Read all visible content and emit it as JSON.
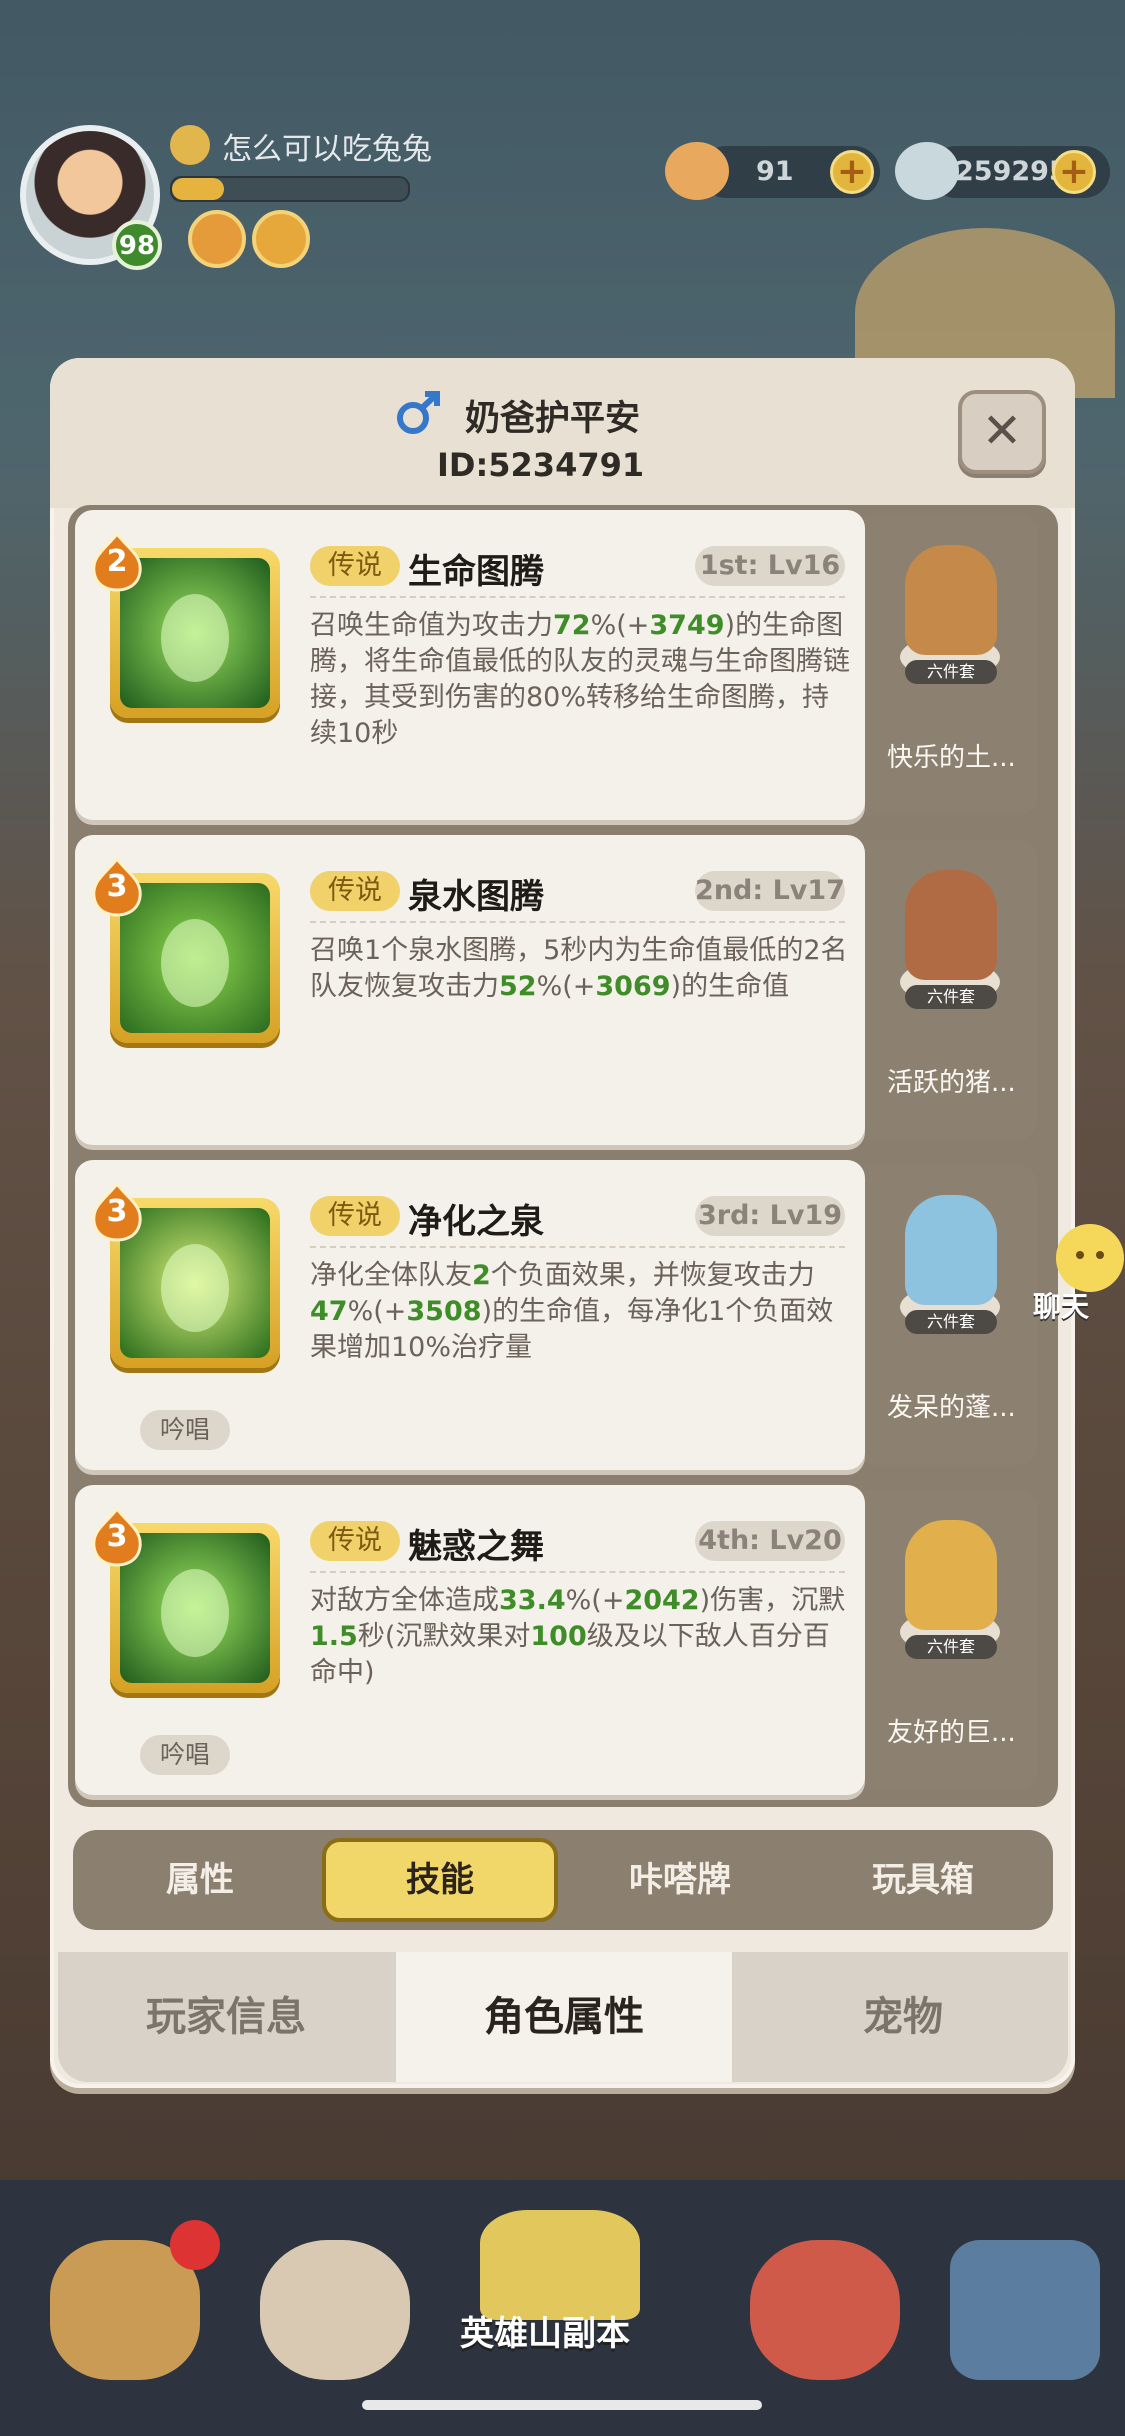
{
  "hud": {
    "player_name": "怎么可以吃兔兔",
    "level": "98",
    "xp_fraction": 0.22,
    "currency": [
      {
        "icon": "shell-currency-icon",
        "value": "91"
      },
      {
        "icon": "pearl-currency-icon",
        "value": "259295"
      }
    ],
    "plus_symbol": "+"
  },
  "dialog": {
    "gender_icon": "male-symbol-icon",
    "owner_name": "奶爸护平安",
    "owner_id": "ID:5234791",
    "close_symbol": "✕"
  },
  "skills": [
    {
      "stars": "2",
      "tag": "传说",
      "name": "生命图腾",
      "rank": "1st: Lv16",
      "desc_parts": [
        "召唤生命值为攻击力",
        "72",
        "%(+",
        "3749",
        ")的生命图腾，将生命值最低的队友的灵魂与生命图腾链接，其受到伤害的80%转移给生命图腾，持续10秒"
      ],
      "chant": "",
      "icon": "life-totem-icon",
      "figure_name": "快乐的土...",
      "figure_icon": "happy-earth-figure-icon",
      "set_tag": "六件套"
    },
    {
      "stars": "3",
      "tag": "传说",
      "name": "泉水图腾",
      "rank": "2nd: Lv17",
      "desc_parts": [
        "召唤1个泉水图腾，5秒内为生命值最低的2名队友恢复攻击力",
        "52",
        "%(+",
        "3069",
        ")的生命值"
      ],
      "chant": "",
      "icon": "spring-totem-icon",
      "figure_name": "活跃的猪...",
      "figure_icon": "active-boar-figure-icon",
      "set_tag": "六件套"
    },
    {
      "stars": "3",
      "tag": "传说",
      "name": "净化之泉",
      "rank": "3rd: Lv19",
      "desc_parts": [
        "净化全体队友",
        "2",
        "个负面效果，并恢复攻击力",
        "47",
        "%(+",
        "3508",
        ")的生命值，每净化1个负面效果增加10%治疗量"
      ],
      "chant": "吟唱",
      "icon": "purify-spring-icon",
      "figure_name": "发呆的蓬...",
      "figure_icon": "dazed-figure-icon",
      "set_tag": "六件套"
    },
    {
      "stars": "3",
      "tag": "传说",
      "name": "魅惑之舞",
      "rank": "4th: Lv20",
      "desc_parts": [
        "对敌方全体造成",
        "33.4",
        "%(+",
        "2042",
        ")伤害，沉默",
        "1.5",
        "秒(沉默效果对",
        "100",
        "级及以下敌人百分百命中)"
      ],
      "chant": "吟唱",
      "icon": "charm-dance-icon",
      "figure_name": "友好的巨...",
      "figure_icon": "friendly-giant-figure-icon",
      "set_tag": "六件套"
    }
  ],
  "sub_tabs": [
    "属性",
    "技能",
    "咔嗒牌",
    "玩具箱"
  ],
  "bottom_tabs": [
    "玩家信息",
    "角色属性",
    "宠物"
  ],
  "chat_label": "聊天",
  "nav": {
    "center_label": "英雄山副本"
  },
  "colors": {
    "accent_gold": "#f1d769",
    "value_green": "#3e8d28",
    "panel_bg": "#efe9df"
  }
}
